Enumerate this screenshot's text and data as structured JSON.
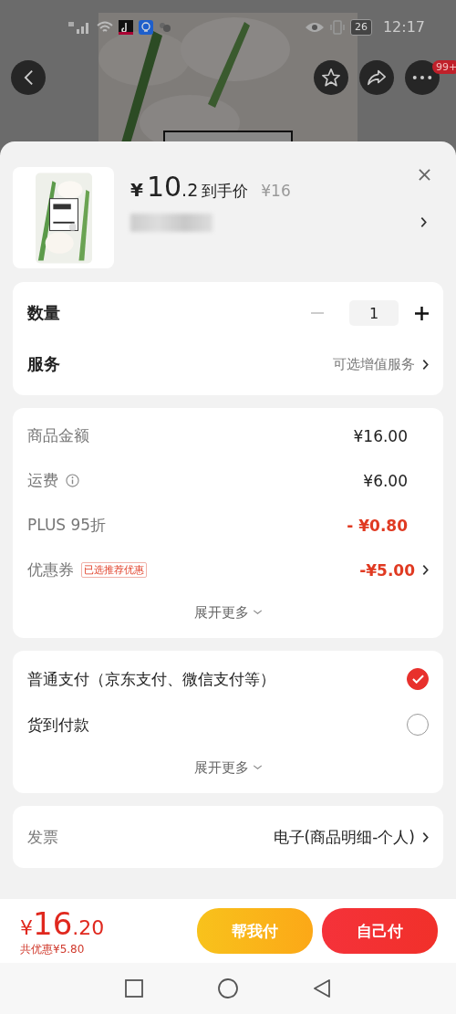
{
  "status_bar": {
    "battery": "26",
    "time": "12:17"
  },
  "top_bar": {
    "badge": "99+"
  },
  "product": {
    "currency": "¥",
    "price_int": "10",
    "price_dec": ".2",
    "price_label": "到手价",
    "original_price": "¥16"
  },
  "options": [
    {
      "kind": "stepper",
      "label": "数量",
      "value": "1"
    },
    {
      "kind": "link",
      "label": "服务",
      "value": "可选增值服务"
    }
  ],
  "fees": [
    {
      "label": "商品金额",
      "value": "¥16.00",
      "kind": "normal"
    },
    {
      "label": "运费",
      "value": "¥6.00",
      "kind": "info"
    },
    {
      "label": "PLUS 95折",
      "value": "- ¥0.80",
      "kind": "discount"
    },
    {
      "label": "优惠券",
      "value": "-¥5.00",
      "kind": "coupon",
      "tag": "已选推荐优惠"
    }
  ],
  "fees_more": "展开更多",
  "payments": [
    {
      "label": "普通支付（京东支付、微信支付等）",
      "selected": true
    },
    {
      "label": "货到付款",
      "selected": false
    }
  ],
  "payments_more": "展开更多",
  "invoice": {
    "label": "发票",
    "value": "电子(商品明细-个人)"
  },
  "footer": {
    "currency": "¥",
    "total_int": "16",
    "total_dec": ".20",
    "savings": "共优惠¥5.80",
    "buttons": [
      {
        "label": "帮我付",
        "kind": "secondary"
      },
      {
        "label": "自己付",
        "kind": "primary"
      }
    ]
  }
}
